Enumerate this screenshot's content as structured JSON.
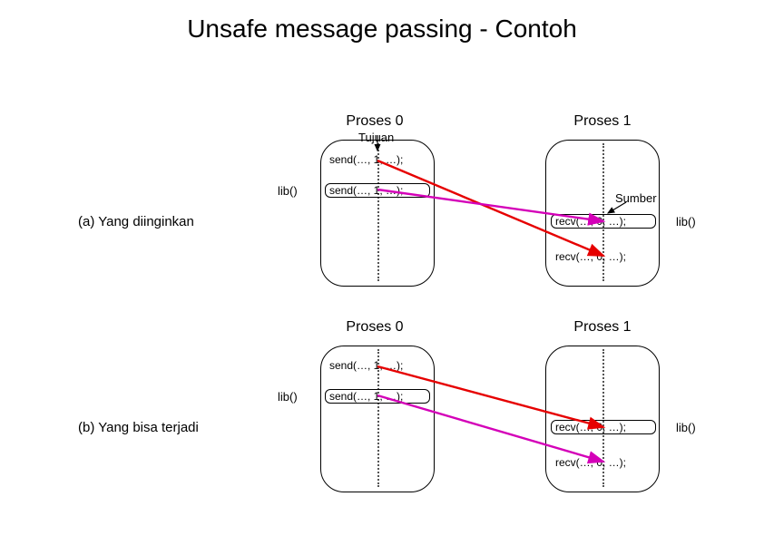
{
  "title": "Unsafe message passing - Contoh",
  "proc0_a": "Proses 0",
  "proc1_a": "Proses 1",
  "proc0_b": "Proses 0",
  "proc1_b": "Proses 1",
  "tujuan": "Tujuan",
  "sumber": "Sumber",
  "lib_a_left": "lib()",
  "lib_a_right": "lib()",
  "lib_b_left": "lib()",
  "lib_b_right": "lib()",
  "send1_a": "send(…, 1, …);",
  "send2_a": "send(…, 1, …);",
  "recv1_a": "recv(…, 0, …);",
  "recv2_a": "recv(…, 0, …);",
  "send1_b": "send(…, 1, …);",
  "send2_b": "send(…, 1, …);",
  "recv1_b": "recv(…, 0, …);",
  "recv2_b": "recv(…, 0, …);",
  "case_a": "(a) Yang diinginkan",
  "case_b": "(b) Yang bisa terjadi"
}
